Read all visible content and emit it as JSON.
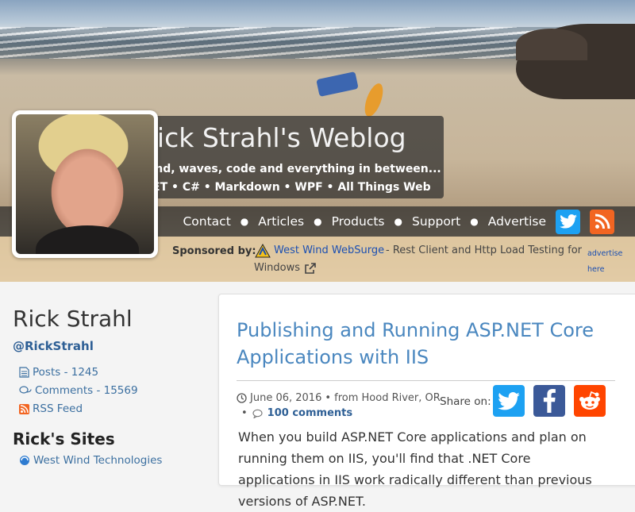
{
  "header": {
    "blog_title": "Rick Strahl's Weblog",
    "tagline": "Wind, waves, code and everything in between...",
    "topics": ".NET • C# • Markdown • WPF • All Things Web"
  },
  "nav": {
    "items": [
      "Contact",
      "Articles",
      "Products",
      "Support",
      "Advertise"
    ]
  },
  "sponsor": {
    "label": "Sponsored by:",
    "link": "West Wind WebSurge",
    "text": "- Rest Client and Http Load Testing for",
    "text2": "Windows",
    "advertise_line1": "advertise",
    "advertise_line2": "here"
  },
  "sidebar": {
    "name": "Rick Strahl",
    "handle": "@RickStrahl",
    "posts": "Posts - 1245",
    "comments": "Comments - 15569",
    "rss": "RSS Feed",
    "sites_heading": "Rick's Sites",
    "site1": "West Wind Technologies"
  },
  "post": {
    "title": "Publishing and Running ASP.NET Core Applications with IIS",
    "date": "June 06, 2016",
    "location": "• from Hood River, OR",
    "comments": "100 comments",
    "share_label": "Share on:",
    "body": "When you build ASP.NET Core applications and plan on running them on IIS, you'll find that .NET Core applications in IIS work radically different than previous versions of ASP.NET."
  },
  "colors": {
    "link": "#4a87bf",
    "twitter": "#1da1f2",
    "facebook": "#3b5998",
    "reddit": "#ff4500",
    "rss": "#f26522"
  }
}
